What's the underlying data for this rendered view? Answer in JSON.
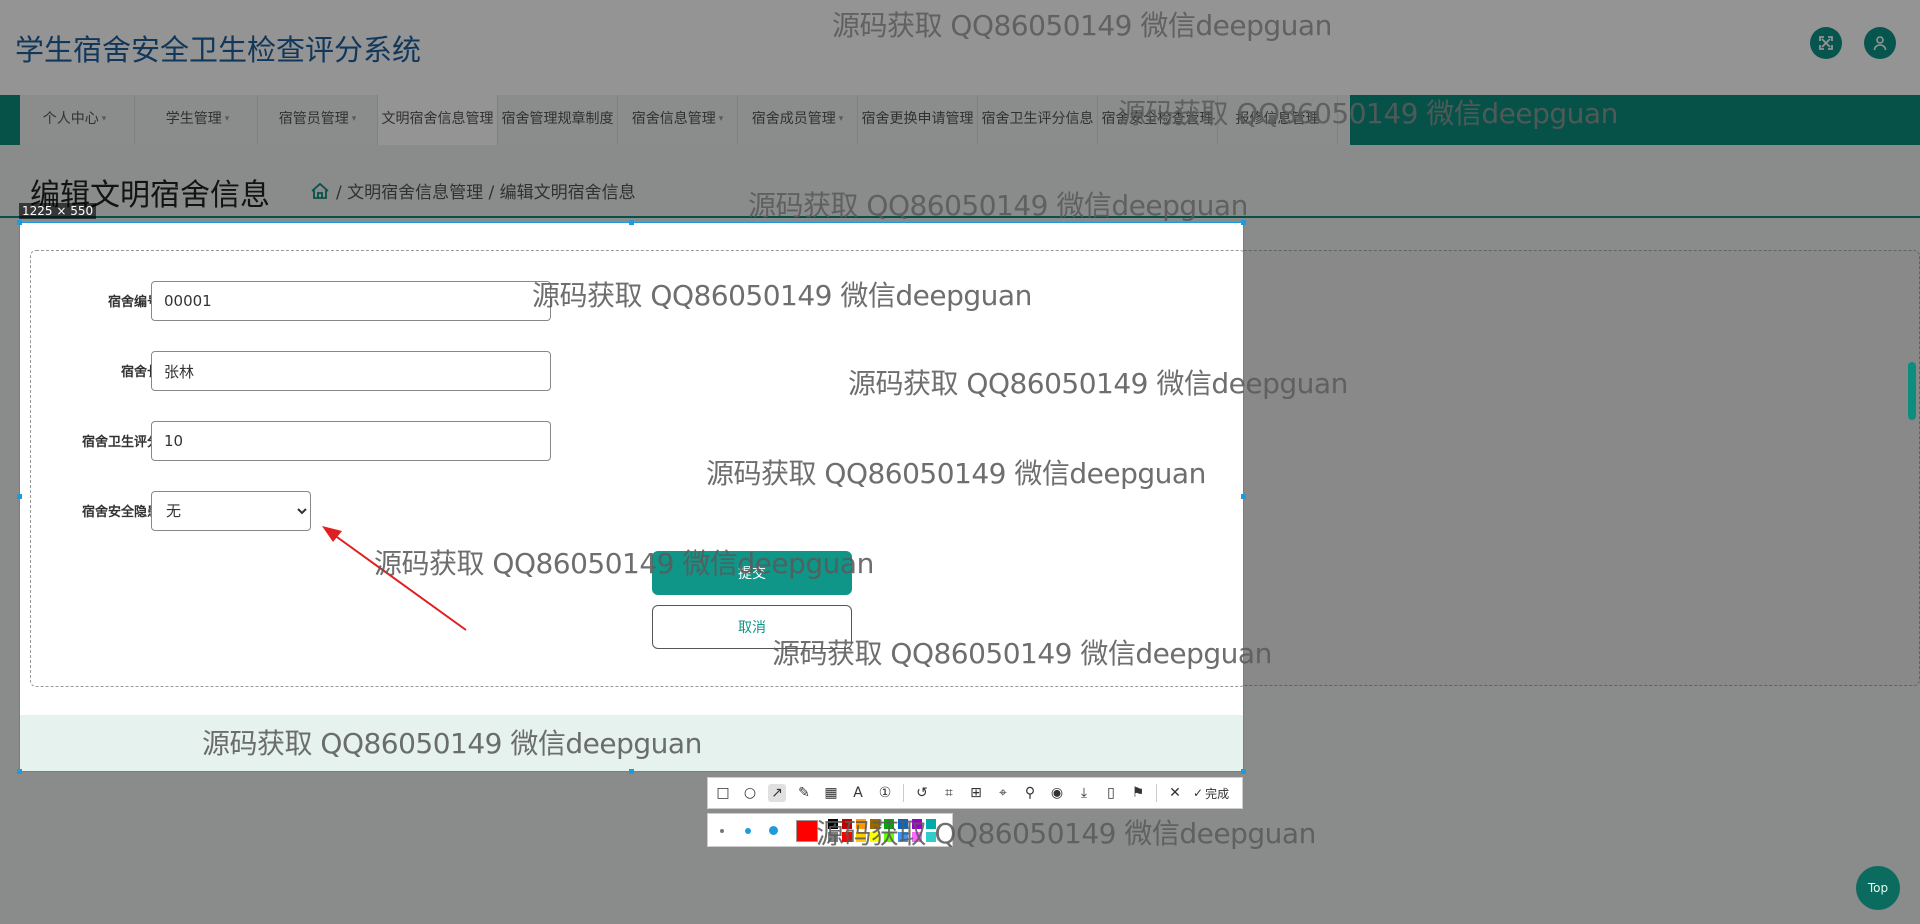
{
  "app": {
    "title": "学生宿舍安全卫生检查评分系统",
    "fullscreen_icon": "fullscreen-icon",
    "user_icon": "user-icon"
  },
  "nav": {
    "items": [
      {
        "label": "个人中心",
        "sub": ""
      },
      {
        "label": "学生管理",
        "sub": ""
      },
      {
        "label": "宿管员管理",
        "sub": ""
      },
      {
        "label": "文明宿舍信息管理",
        "sub": ""
      },
      {
        "label": "宿舍管理规章制度",
        "sub": "管理"
      },
      {
        "label": "宿舍信息管理",
        "sub": ""
      },
      {
        "label": "宿舍成员管理",
        "sub": ""
      },
      {
        "label": "宿舍更换申请管理",
        "sub": ""
      },
      {
        "label": "宿舍卫生评分信息",
        "sub": "管理"
      },
      {
        "label": "宿舍安全检查管理",
        "sub": ""
      },
      {
        "label": "报修信息管理",
        "sub": ""
      }
    ]
  },
  "page": {
    "title": "编辑文明宿舍信息",
    "breadcrumb": "/ 文明宿舍信息管理 / 编辑文明宿舍信息"
  },
  "capture": {
    "size_label": "1225 × 550"
  },
  "form": {
    "fields": [
      {
        "label": "宿舍编号",
        "value": "00001"
      },
      {
        "label": "宿舍长",
        "value": "张林"
      },
      {
        "label": "宿舍卫生评分",
        "value": "10"
      }
    ],
    "hazard": {
      "label": "宿舍安全隐患",
      "selected": "无"
    },
    "submit_label": "提交",
    "cancel_label": "取消"
  },
  "toolbar": {
    "done_label": "完成",
    "tools": [
      "rectangle-icon",
      "ellipse-icon",
      "arrow-icon",
      "pen-icon",
      "mosaic-icon",
      "text-icon",
      "number-icon",
      "undo-icon",
      "ocr-icon",
      "translate-icon",
      "scan-icon",
      "pin-icon",
      "record-icon",
      "save-icon",
      "copy-icon",
      "bookmark-icon",
      "close-icon"
    ]
  },
  "palette": {
    "current_color": "#ff0000",
    "colors": [
      "#000000",
      "#c00000",
      "#ff9900",
      "#996600",
      "#00aa00",
      "#0066cc",
      "#9900cc",
      "#00aaaa",
      "#808080",
      "#ff0000",
      "#ffcc00",
      "#ffff00",
      "#66ff00",
      "#3399ff",
      "#ff66ff",
      "#33cccc"
    ]
  },
  "scroll_top_label": "Top",
  "watermark_text": "源码获取 QQ86050149 微信deepguan",
  "colors": {
    "accent": "#0c8e7f",
    "title": "#1e5f9e",
    "selection": "#1e9be0"
  }
}
